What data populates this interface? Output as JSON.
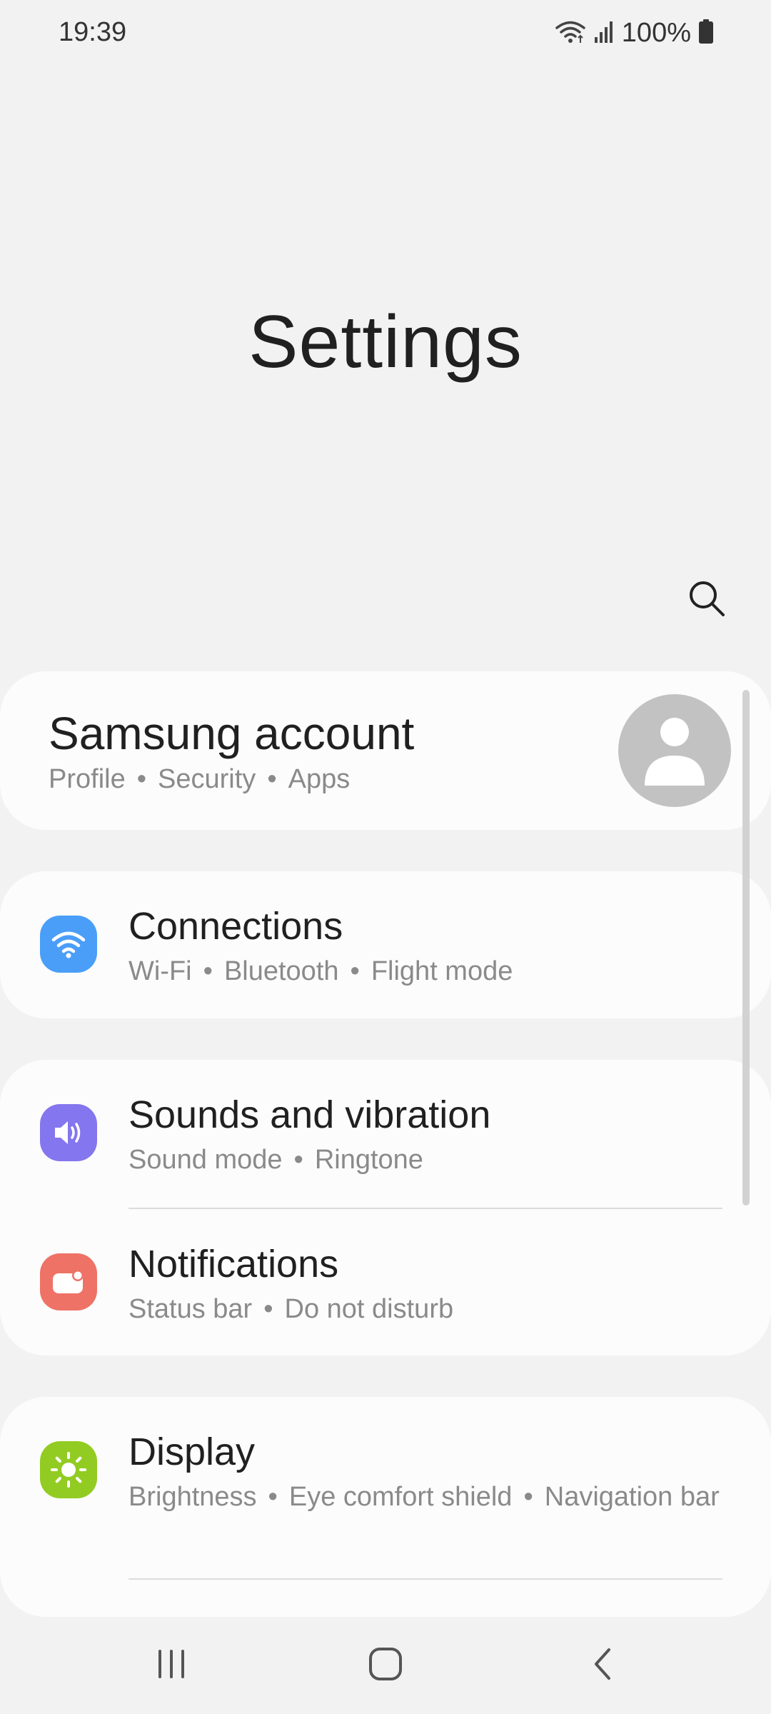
{
  "status_bar": {
    "time": "19:39",
    "battery": "100%",
    "icons": [
      "wifi-icon",
      "signal-icon",
      "battery-icon"
    ]
  },
  "header": {
    "title": "Settings",
    "search_icon": "search-icon"
  },
  "account": {
    "title": "Samsung account",
    "subtitle": [
      "Profile",
      "Security",
      "Apps"
    ]
  },
  "items": [
    {
      "title": "Connections",
      "subtitle": [
        "Wi-Fi",
        "Bluetooth",
        "Flight mode"
      ],
      "icon": "wifi-icon",
      "color": "#4a9ef8"
    },
    {
      "title": "Sounds and vibration",
      "subtitle": [
        "Sound mode",
        "Ringtone"
      ],
      "icon": "speaker-icon",
      "color": "#8476ee"
    },
    {
      "title": "Notifications",
      "subtitle": [
        "Status bar",
        "Do not disturb"
      ],
      "icon": "notification-icon",
      "color": "#ee7266"
    },
    {
      "title": "Display",
      "subtitle": [
        "Brightness",
        "Eye comfort shield",
        "Navigation bar"
      ],
      "icon": "brightness-icon",
      "color": "#92cc22"
    }
  ],
  "nav": {
    "recents": "recents-icon",
    "home": "home-icon",
    "back": "back-icon"
  }
}
